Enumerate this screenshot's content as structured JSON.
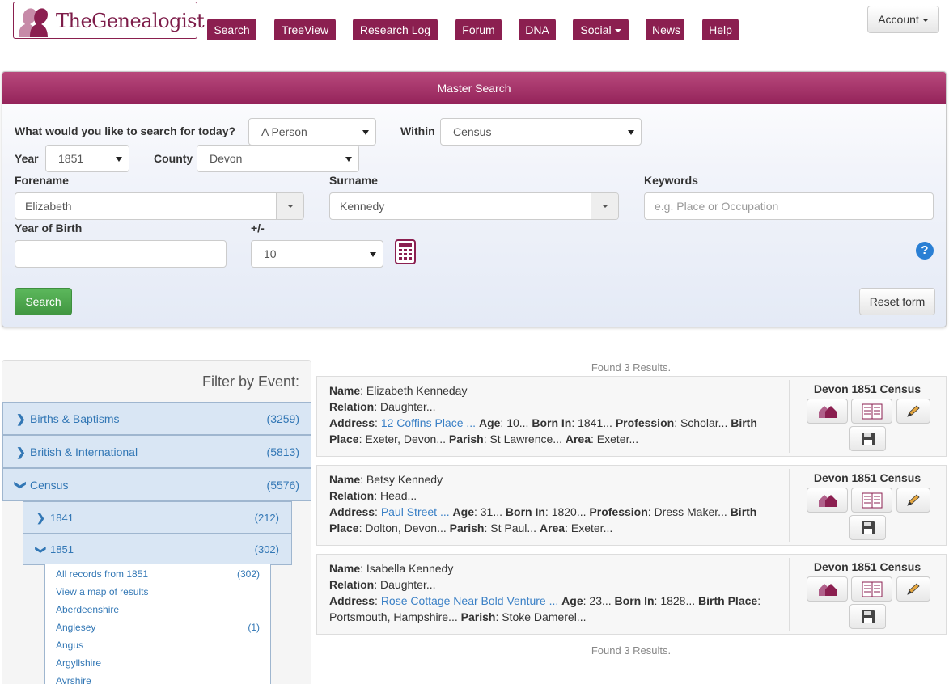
{
  "header": {
    "logo_text": "TheGenealogist",
    "nav": [
      "Search",
      "TreeView",
      "Research Log",
      "Forum",
      "DNA",
      "Social",
      "News",
      "Help"
    ],
    "account_label": "Account"
  },
  "search_form": {
    "title": "Master Search",
    "question_label": "What would you like to search for today?",
    "search_for": "A Person",
    "within_label": "Within",
    "within": "Census",
    "year_label": "Year",
    "year": "1851",
    "county_label": "County",
    "county": "Devon",
    "forename_label": "Forename",
    "forename": "Elizabeth",
    "surname_label": "Surname",
    "surname": "Kennedy",
    "keywords_label": "Keywords",
    "keywords_placeholder": "e.g. Place or Occupation",
    "yob_label": "Year of Birth",
    "yob_value": "",
    "plusminus_label": "+/-",
    "plusminus": "10",
    "help_glyph": "?",
    "search_button": "Search",
    "reset_button": "Reset form"
  },
  "filter": {
    "title": "Filter by Event:",
    "facets": [
      {
        "label": "Births & Baptisms",
        "count": "(3259)",
        "expanded": false
      },
      {
        "label": "British & International",
        "count": "(5813)",
        "expanded": false
      },
      {
        "label": "Census",
        "count": "(5576)",
        "expanded": true
      }
    ],
    "sub_facets": [
      {
        "label": "1841",
        "count": "(212)",
        "expanded": false
      },
      {
        "label": "1851",
        "count": "(302)",
        "expanded": true
      }
    ],
    "leaves": [
      {
        "label": "All records from 1851",
        "count": "(302)"
      },
      {
        "label": "View a map of results",
        "count": ""
      },
      {
        "label": "Aberdeenshire",
        "count": ""
      },
      {
        "label": "Anglesey",
        "count": "(1)"
      },
      {
        "label": "Angus",
        "count": ""
      },
      {
        "label": "Argyllshire",
        "count": ""
      },
      {
        "label": "Ayrshire",
        "count": ""
      }
    ]
  },
  "results": {
    "found_text": "Found 3 Results.",
    "items": [
      {
        "source": "Devon 1851 Census",
        "name": "Elizabeth Kenneday",
        "relation": "Daughter...",
        "address": "12 Coffins Place ...",
        "age": "10...",
        "born_in": "1841...",
        "profession": "Scholar...",
        "birth_place": "Exeter, Devon...",
        "parish": "St Lawrence...",
        "area": "Exeter..."
      },
      {
        "source": "Devon 1851 Census",
        "name": "Betsy Kennedy",
        "relation": "Head...",
        "address": "Paul Street ...",
        "age": "31...",
        "born_in": "1820...",
        "profession": "Dress Maker...",
        "birth_place": "Dolton, Devon...",
        "parish": "St Paul...",
        "area": "Exeter..."
      },
      {
        "source": "Devon 1851 Census",
        "name": "Isabella Kennedy",
        "relation": "Daughter...",
        "address": "Rose Cottage Near Bold Venture ...",
        "age": "23...",
        "born_in": "1828...",
        "birth_place": "Portsmouth, Hampshire...",
        "parish": "Stoke Damerel..."
      }
    ]
  },
  "field_labels": {
    "name": "Name",
    "relation": "Relation",
    "address": "Address",
    "age": "Age",
    "born_in": "Born In",
    "profession": "Profession",
    "birth_place": "Birth Place",
    "parish": "Parish",
    "area": "Area"
  },
  "icons": {
    "household": "household-icon",
    "transcript": "transcript-icon",
    "edit": "pencil-icon",
    "save": "save-icon",
    "calculator": "calculator-icon"
  },
  "colors": {
    "brand": "#8b1f50",
    "panel_header": "#a63069",
    "link": "#3a80c6",
    "success": "#5cb85c",
    "facet_bg": "#d9e6f4"
  }
}
